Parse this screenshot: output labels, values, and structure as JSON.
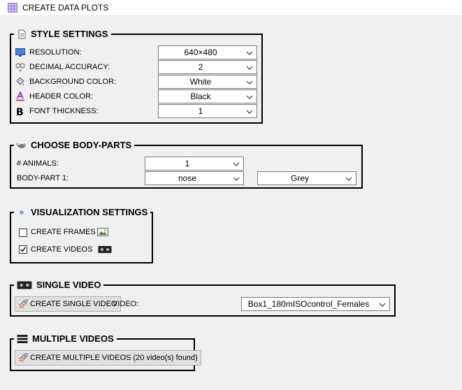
{
  "window": {
    "title": "CREATE DATA PLOTS",
    "icon": "grid-table-icon"
  },
  "style_settings": {
    "title": "STYLE SETTINGS",
    "rows": [
      {
        "label": "RESOLUTION:",
        "value": "640×480",
        "icon": "monitor-icon"
      },
      {
        "label": "DECIMAL ACCURACY:",
        "value": "2",
        "icon": "decimal-icon"
      },
      {
        "label": "BACKGROUND COLOR:",
        "value": "White",
        "icon": "paint-bucket-icon"
      },
      {
        "label": "HEADER COLOR:",
        "value": "Black",
        "icon": "font-color-icon"
      },
      {
        "label": "FONT THICKNESS:",
        "value": "1",
        "icon": "bold-icon"
      }
    ]
  },
  "body_parts": {
    "title": "CHOOSE BODY-PARTS",
    "animals_label": "# ANIMALS:",
    "animals_value": "1",
    "bp1_label": "BODY-PART 1:",
    "bp1_value": "nose",
    "bp1_color": "Grey"
  },
  "visualization": {
    "title": "VISUALIZATION SETTINGS",
    "frames_label": "CREATE FRAMES",
    "frames_checked": false,
    "videos_label": "CREATE VIDEOS",
    "videos_checked": true
  },
  "single_video": {
    "title": "SINGLE VIDEO",
    "button_label": "CREATE SINGLE VIDEO",
    "video_label": "VIDEO:",
    "video_value": "Box1_180mISOcontrol_Females"
  },
  "multiple_videos": {
    "title": "MULTIPLE VIDEOS",
    "button_label": "CREATE MULTIPLE VIDEOS (20 video(s) found)"
  }
}
